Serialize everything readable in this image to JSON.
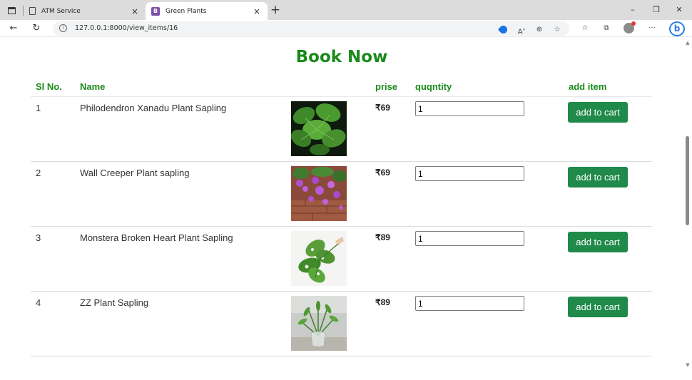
{
  "browser": {
    "tabs": [
      {
        "title": "ATM Service",
        "active": false
      },
      {
        "title": "Green Plants",
        "active": true
      }
    ],
    "url": "127.0.0.1:8000/view_items/16",
    "window_controls": {
      "minimize": "–",
      "restore": "❐",
      "close": "✕"
    }
  },
  "page": {
    "title": "Book Now",
    "columns": {
      "sl": "Sl No.",
      "name": "Name",
      "price": "prise",
      "quantity": "quqntity",
      "add": "add item"
    },
    "button_label": "add to cart",
    "items": [
      {
        "sl": "1",
        "name": "Philodendron Xanadu Plant Sapling",
        "price": "₹69",
        "qty": "1",
        "image": "plant-photo"
      },
      {
        "sl": "2",
        "name": "Wall Creeper Plant sapling",
        "price": "₹69",
        "qty": "1",
        "image": "plant-photo"
      },
      {
        "sl": "3",
        "name": "Monstera Broken Heart Plant Sapling",
        "price": "₹89",
        "qty": "1",
        "image": "plant-photo"
      },
      {
        "sl": "4",
        "name": "ZZ Plant Sapling",
        "price": "₹89",
        "qty": "1",
        "image": "plant-photo"
      }
    ]
  },
  "colors": {
    "accent_green": "#1a8a1a",
    "button_green": "#1f8a4a"
  }
}
